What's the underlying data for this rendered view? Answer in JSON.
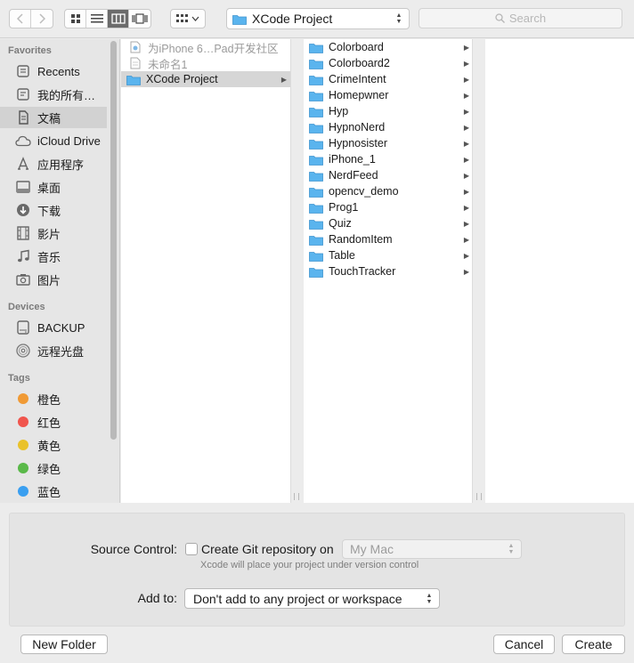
{
  "toolbar": {
    "path_label": "XCode Project",
    "search_placeholder": "Search"
  },
  "sidebar": {
    "favorites_heading": "Favorites",
    "devices_heading": "Devices",
    "tags_heading": "Tags",
    "favorites": [
      {
        "label": "Recents",
        "icon": "clock-icon"
      },
      {
        "label": "我的所有…",
        "icon": "all-files-icon"
      },
      {
        "label": "文稿",
        "icon": "documents-icon",
        "selected": true
      },
      {
        "label": "iCloud Drive",
        "icon": "cloud-icon"
      },
      {
        "label": "应用程序",
        "icon": "applications-icon"
      },
      {
        "label": "桌面",
        "icon": "desktop-icon"
      },
      {
        "label": "下载",
        "icon": "download-icon"
      },
      {
        "label": "影片",
        "icon": "film-icon"
      },
      {
        "label": "音乐",
        "icon": "music-icon"
      },
      {
        "label": "图片",
        "icon": "camera-icon"
      }
    ],
    "devices": [
      {
        "label": "BACKUP",
        "icon": "drive-icon"
      },
      {
        "label": "远程光盘",
        "icon": "disc-icon"
      }
    ],
    "tags": [
      {
        "label": "橙色",
        "color": "#f09a35"
      },
      {
        "label": "红色",
        "color": "#f0554d"
      },
      {
        "label": "黄色",
        "color": "#e9c22b"
      },
      {
        "label": "绿色",
        "color": "#5ab949"
      },
      {
        "label": "蓝色",
        "color": "#3a9ff0"
      }
    ]
  },
  "column1": [
    {
      "label": "为iPhone 6…Pad开发社区",
      "muted": true
    },
    {
      "label": "未命名1",
      "muted": true
    },
    {
      "label": "XCode Project",
      "selected": true
    }
  ],
  "column2": [
    "Colorboard",
    "Colorboard2",
    "CrimeIntent",
    "Homepwner",
    "Hyp",
    "HypnoNerd",
    "Hypnosister",
    "iPhone_1",
    "NerdFeed",
    "opencv_demo",
    "Prog1",
    "Quiz",
    "RandomItem",
    "Table",
    "TouchTracker"
  ],
  "form": {
    "source_control_label": "Source Control:",
    "git_checkbox_label": "Create Git repository on",
    "git_location": "My Mac",
    "hint": "Xcode will place your project under version control",
    "add_to_label": "Add to:",
    "add_to_value": "Don't add to any project or workspace"
  },
  "buttons": {
    "new_folder": "New Folder",
    "cancel": "Cancel",
    "create": "Create"
  },
  "colors": {
    "folder": "#5ab4ee",
    "selection": "#d6d6d6"
  }
}
